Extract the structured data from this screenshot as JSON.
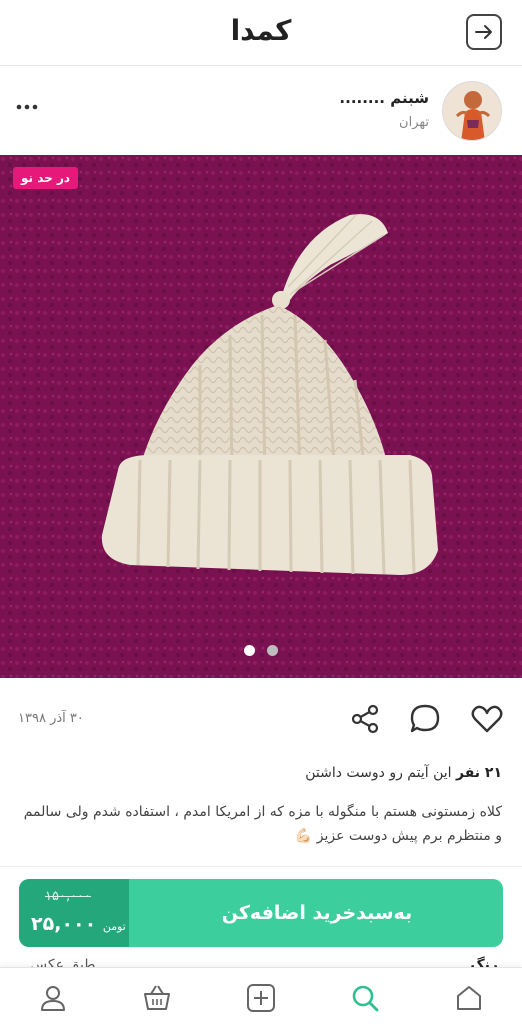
{
  "app": {
    "title": "کمدا"
  },
  "seller": {
    "name": "شبنم ........",
    "city": "تهران"
  },
  "photo": {
    "badge": "در حد نو",
    "slide_count": 2,
    "active_slide": 1
  },
  "post": {
    "date": "۳۰ آذر ۱۳۹۸"
  },
  "likes": {
    "count": "۲۱ نفر",
    "text": "این آیتم رو دوست داشتن"
  },
  "description": {
    "line1": "کلاه زمستونی هستم با منگوله با مزه که از امریکا امدم ، استفاده شدم ولی سالمم",
    "line2": "و منتظرم برم پیش دوست عزیز 💪🏻"
  },
  "cart": {
    "label": "به‌سبدخرید اضافه‌کن",
    "old_price": "۱۵۰,۰۰۰",
    "new_price": "۲۵,۰۰۰",
    "currency": "تومن"
  },
  "details_peek": {
    "right": "رنگ",
    "left": "طبق عکس"
  },
  "colors": {
    "accent": "#3ccf9d",
    "accent_dark": "#23a77b",
    "badge": "#e6197a",
    "search_active": "#2fbf8f"
  },
  "icons": {
    "back": "arrow-right-box-icon",
    "more": "more-horizontal-icon",
    "heart": "heart-icon",
    "comment": "comment-icon",
    "share": "share-icon",
    "home": "home-icon",
    "search": "search-icon",
    "add": "add-square-icon",
    "basket": "basket-icon",
    "profile": "profile-icon"
  }
}
